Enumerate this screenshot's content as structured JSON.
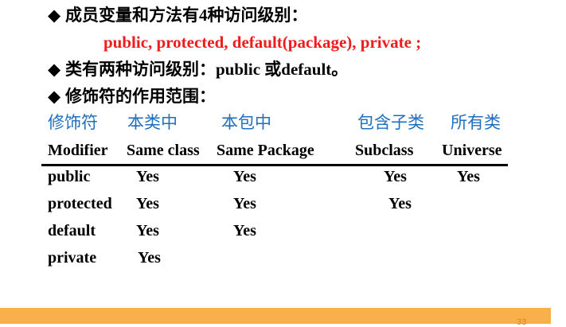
{
  "bullets": {
    "line1": "成员变量和方法有4种访问级别：",
    "line2": "public, protected, default(package), private ;",
    "line3": "类有两种访问级别：public 或default。",
    "line4": "修饰符的作用范围：",
    "bullet_glyph": "◆"
  },
  "table": {
    "cn_headers": [
      "修饰符",
      "本类中",
      "本包中",
      "包含子类",
      "所有类"
    ],
    "en_headers": [
      "Modifier",
      "Same class",
      "Same Package",
      "Subclass",
      "Universe"
    ],
    "rows": [
      [
        "public",
        "Yes",
        "Yes",
        "Yes",
        "Yes"
      ],
      [
        "protected",
        "Yes",
        "Yes",
        "Yes",
        ""
      ],
      [
        "default",
        "Yes",
        "Yes",
        "",
        ""
      ],
      [
        "private",
        "Yes",
        "",
        "",
        ""
      ]
    ]
  },
  "footer": {
    "page_number": "33"
  },
  "colors": {
    "red_text": "#ee1c1c",
    "blue_header": "#1f6fbd",
    "footer_bar": "#f9b04a"
  }
}
